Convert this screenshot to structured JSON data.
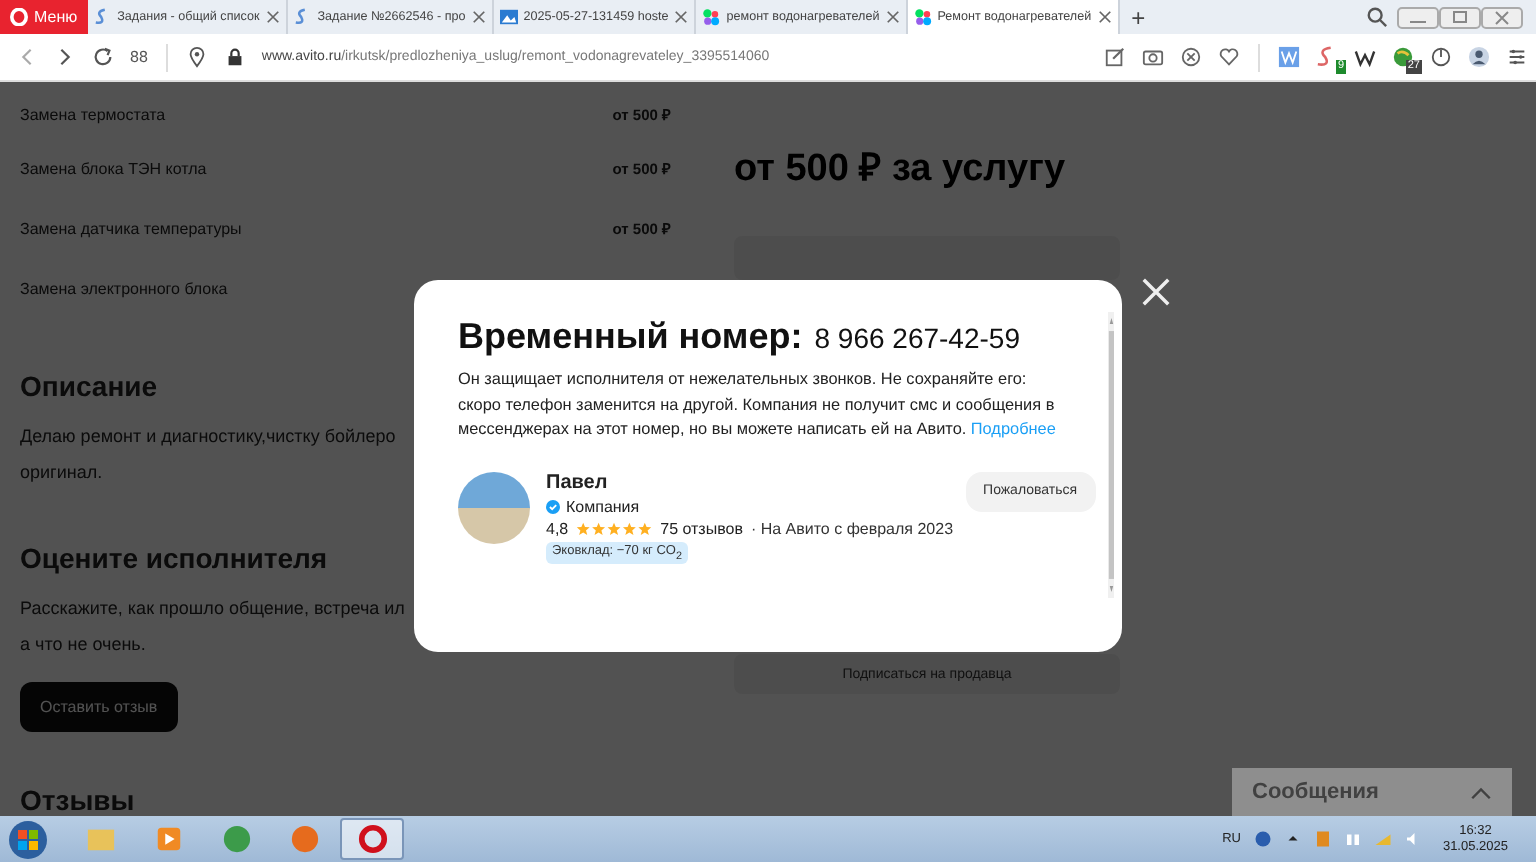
{
  "browser": {
    "menu_label": "Меню",
    "tabs": [
      {
        "title": "Задания - общий список",
        "selected": false
      },
      {
        "title": "Задание №2662546 - про",
        "selected": false
      },
      {
        "title": "2025-05-27-131459 hoste",
        "selected": false
      },
      {
        "title": "ремонт водонагревателей",
        "selected": false
      },
      {
        "title": "Ремонт водонагревателей",
        "selected": true
      }
    ],
    "new_tab": "+",
    "url_host": "www.avito.ru",
    "url_path": "/irkutsk/predlozheniya_uslug/remont_vodonagrevateley_3395514060",
    "speed_dial": "88",
    "extension_badges": [
      "9",
      "27"
    ]
  },
  "page": {
    "services": [
      {
        "name": "Замена термостата",
        "price": "от 500 ₽"
      },
      {
        "name": "Замена блока ТЭН котла",
        "price": "от 500 ₽"
      },
      {
        "name": "Замена датчика температуры",
        "price": "от 500 ₽"
      },
      {
        "name": "Замена электронного блока"
      }
    ],
    "description_heading": "Описание",
    "description_lines": [
      "Делаю ремонт и диагностику,чистку бойлеро",
      "оригинал."
    ],
    "rate_heading": "Оцените исполнителя",
    "rate_lines": [
      "Расскажите, как прошло общение, встреча ил",
      "а что не очень."
    ],
    "review_button": "Оставить отзыв",
    "reviews_heading": "Отзывы",
    "price_heading": "от 500 ₽ за услугу",
    "subscribe_button": "Подписаться на продавца",
    "messages_label": "Сообщения"
  },
  "modal": {
    "title": "Временный номер:",
    "phone": "8 966 267-42-59",
    "text": "Он защищает исполнителя от нежелательных звонков. Не сохраняйте его: скоро телефон заменится на другой. Компания не получит смс и сообщения в мессенджерах на этот номер, но вы можете написать ей на Авито.",
    "link": "Подробнее",
    "seller": {
      "name": "Павел",
      "type": "Компания",
      "rating": "4,8",
      "stars": 5,
      "reviews": "75 отзывов",
      "since": "· На Авито с февраля 2023",
      "eco_badge": "Эковклад: −70 кг CO$_{2}$"
    },
    "complain_button": "Пожаловаться"
  },
  "taskbar": {
    "apps": [
      {
        "kind": "folder",
        "selected": false
      },
      {
        "kind": "media",
        "selected": false
      },
      {
        "kind": "chrome",
        "selected": false
      },
      {
        "kind": "firefox",
        "selected": false
      },
      {
        "kind": "opera",
        "selected": true
      }
    ],
    "language": "RU",
    "time": "16:32",
    "date": "31.05.2025"
  }
}
